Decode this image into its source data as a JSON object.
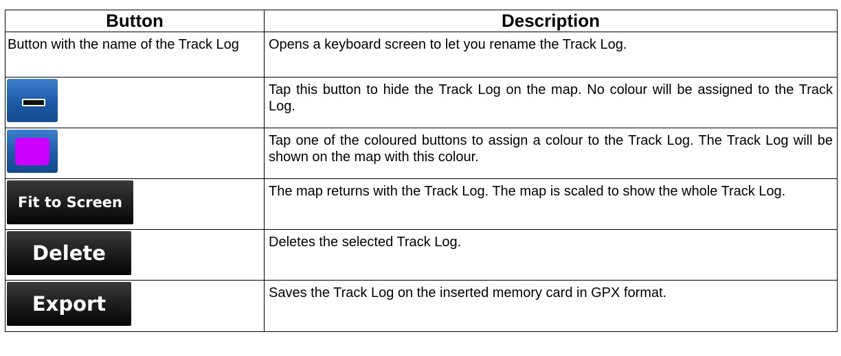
{
  "table": {
    "headers": {
      "button": "Button",
      "description": "Description"
    },
    "rows": [
      {
        "button_text": "Button with the name of the Track Log",
        "description": "Opens a keyboard screen to let you rename the Track Log."
      },
      {
        "button_icon": "hide-track-icon",
        "description": "Tap this button to hide the Track Log on the map. No colour will be assigned to the Track Log."
      },
      {
        "button_icon": "colour-swatch-icon",
        "swatch_color": "#cc00ff",
        "description": "Tap one of the coloured buttons to assign a colour to the Track Log. The Track Log will be shown on the map with this colour."
      },
      {
        "button_label": "Fit to Screen",
        "description": "The map returns with the Track Log. The map is scaled to show the whole Track Log."
      },
      {
        "button_label": "Delete",
        "description": "Deletes the selected Track Log."
      },
      {
        "button_label": "Export",
        "description": "Saves the Track Log on the inserted memory card in GPX format."
      }
    ]
  },
  "colors": {
    "icon_button_blue": "#1d5aa6",
    "dark_button": "#1e1e1e"
  }
}
